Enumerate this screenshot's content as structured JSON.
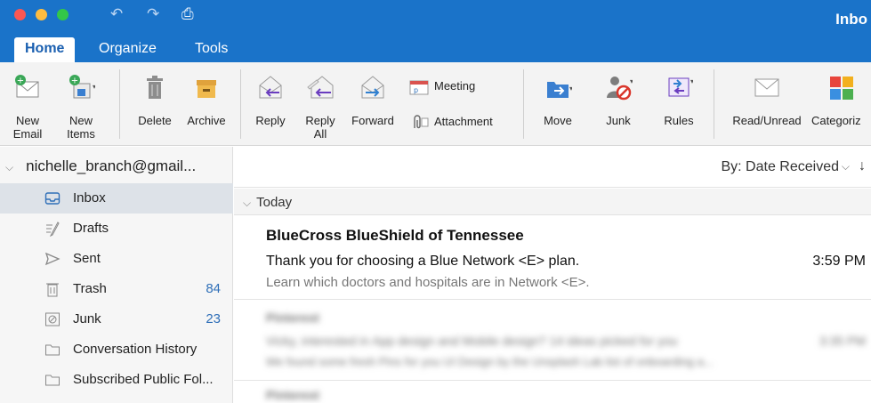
{
  "window": {
    "title": "Inbo"
  },
  "quick_access": {
    "undo_icon": "undo-icon",
    "redo_icon": "redo-icon",
    "print_icon": "print-icon"
  },
  "tabs": [
    {
      "label": "Home",
      "active": true
    },
    {
      "label": "Organize",
      "active": false
    },
    {
      "label": "Tools",
      "active": false
    }
  ],
  "ribbon": {
    "new_email": {
      "line1": "New",
      "line2": "Email"
    },
    "new_items": {
      "line1": "New",
      "line2": "Items"
    },
    "delete": "Delete",
    "archive": "Archive",
    "reply": "Reply",
    "reply_all": {
      "line1": "Reply",
      "line2": "All"
    },
    "forward": "Forward",
    "meeting": "Meeting",
    "attachment": "Attachment",
    "move": "Move",
    "junk": "Junk",
    "rules": "Rules",
    "read_unread": "Read/Unread",
    "categorize": "Categoriz"
  },
  "sidebar": {
    "account": "nichelle_branch@gmail...",
    "folders": [
      {
        "label": "Inbox",
        "count": "",
        "icon": "inbox-icon",
        "selected": true
      },
      {
        "label": "Drafts",
        "count": "",
        "icon": "drafts-icon",
        "selected": false
      },
      {
        "label": "Sent",
        "count": "",
        "icon": "sent-icon",
        "selected": false
      },
      {
        "label": "Trash",
        "count": "84",
        "icon": "trash-icon",
        "selected": false
      },
      {
        "label": "Junk",
        "count": "23",
        "icon": "junk-folder-icon",
        "selected": false
      },
      {
        "label": "Conversation History",
        "count": "",
        "icon": "folder-icon",
        "selected": false
      },
      {
        "label": "Subscribed Public Fol...",
        "count": "",
        "icon": "folder-icon",
        "selected": false
      }
    ]
  },
  "message_list": {
    "sort_label": "By: Date Received",
    "group_label": "Today",
    "messages": [
      {
        "sender": "BlueCross BlueShield of Tennessee",
        "subject": "Thank you for choosing a Blue Network <E> plan.",
        "time": "3:59 PM",
        "preview": "Learn which doctors and hospitals are in Network <E>."
      },
      {
        "sender": "Pinterest",
        "subject": "Vicky, interested in App design and Mobile design? 14 ideas picked for you",
        "time": "3:35 PM",
        "preview": "We found some fresh Pins for you UI Design by the Unsplash Lab list of onboarding a..."
      },
      {
        "sender": "Pinterest",
        "subject": "",
        "time": "",
        "preview": ""
      }
    ]
  },
  "colors": {
    "titlebar": "#1a73c9",
    "accent": "#2f6fb8",
    "selected_folder": "#dde2e8"
  }
}
